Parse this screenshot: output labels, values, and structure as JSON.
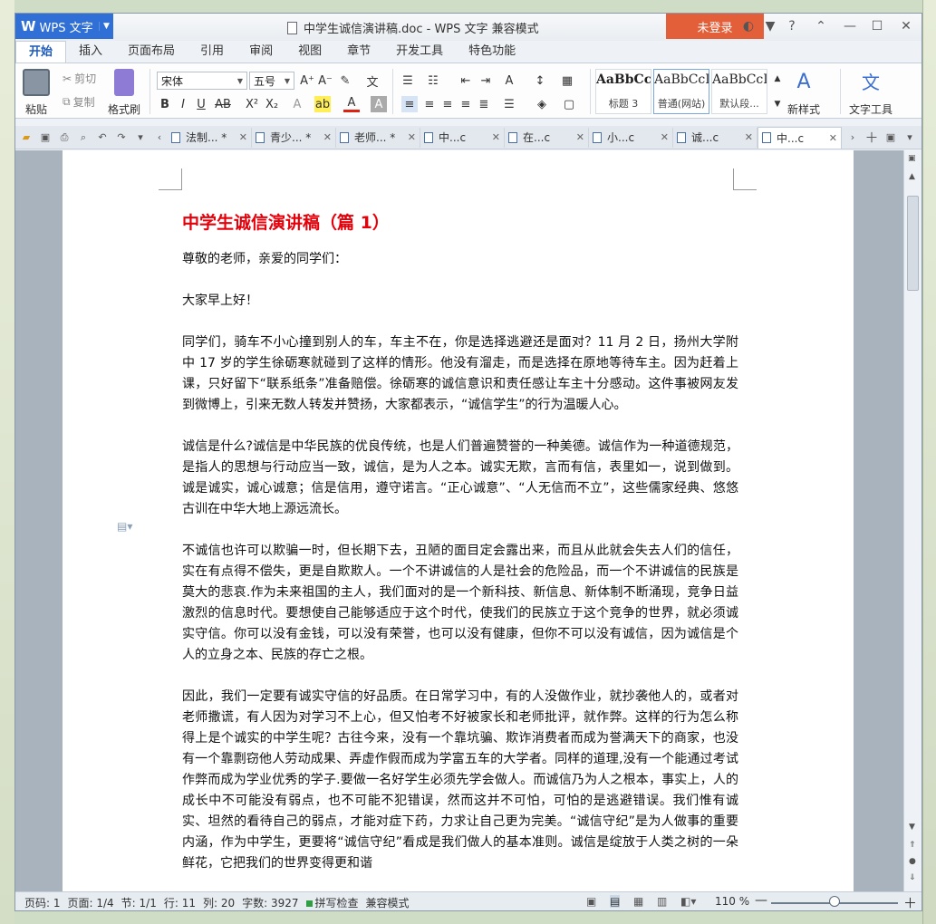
{
  "app": {
    "menu_label": "WPS 文字",
    "logo": "W"
  },
  "title": {
    "text": "中学生诚信演讲稿.doc - WPS 文字 兼容模式"
  },
  "login": {
    "label": "未登录"
  },
  "window_controls": {
    "min": "—",
    "max": "☐",
    "close": "✕"
  },
  "ribbon_tabs": [
    "开始",
    "插入",
    "页面布局",
    "引用",
    "审阅",
    "视图",
    "章节",
    "开发工具",
    "特色功能"
  ],
  "ribbon": {
    "paste": "粘贴",
    "cut": "剪切",
    "copy": "复制",
    "format_painter": "格式刷",
    "font_name": "宋体",
    "font_size": "五号",
    "styles": [
      {
        "preview": "AaBbCcI",
        "name": "标题 3"
      },
      {
        "preview": "AaBbCcD",
        "name": "普通(网站)"
      },
      {
        "preview": "AaBbCcDc",
        "name": "默认段..."
      }
    ],
    "new_style": "新样式",
    "text_tools": "文字工具"
  },
  "doc_tabs": [
    {
      "label": "法制... *"
    },
    {
      "label": "青少... *"
    },
    {
      "label": "老师... *"
    },
    {
      "label": "中...c"
    },
    {
      "label": "在...c"
    },
    {
      "label": "小...c"
    },
    {
      "label": "诚...c"
    },
    {
      "label": "中...c",
      "active": true
    }
  ],
  "document": {
    "heading": "中学生诚信演讲稿（篇 1）",
    "paragraphs": [
      "尊敬的老师，亲爱的同学们：",
      "大家早上好！",
      "同学们，骑车不小心撞到别人的车，车主不在，你是选择逃避还是面对？11 月 2 日，扬州大学附中 17 岁的学生徐砺寒就碰到了这样的情形。他没有溜走，而是选择在原地等待车主。因为赶着上课，只好留下“联系纸条”准备赔偿。徐砺寒的诚信意识和责任感让车主十分感动。这件事被网友发到微博上，引来无数人转发并赞扬，大家都表示，“诚信学生”的行为温暖人心。",
      "诚信是什么?诚信是中华民族的优良传统，也是人们普遍赞誉的一种美德。诚信作为一种道德规范，是指人的思想与行动应当一致，诚信，是为人之本。诚实无欺，言而有信，表里如一，说到做到。诚是诚实，诚心诚意；信是信用，遵守诺言。“正心诚意”、“人无信而不立”，这些儒家经典、悠悠古训在中华大地上源远流长。",
      "不诚信也许可以欺骗一时，但长期下去，丑陋的面目定会露出来，而且从此就会失去人们的信任，实在有点得不偿失，更是自欺欺人。一个不讲诚信的人是社会的危险品，而一个不讲诚信的民族是莫大的悲哀.作为未来祖国的主人，我们面对的是一个新科技、新信息、新体制不断涌现，竞争日益激烈的信息时代。要想使自己能够适应于这个时代，使我们的民族立于这个竞争的世界，就必须诚实守信。你可以没有金钱，可以没有荣誉，也可以没有健康，但你不可以没有诚信，因为诚信是个人的立身之本、民族的存亡之根。",
      "因此，我们一定要有诚实守信的好品质。在日常学习中，有的人没做作业，就抄袭他人的，或者对老师撒谎，有人因为对学习不上心，但又怕考不好被家长和老师批评，就作弊。这样的行为怎么称得上是个诚实的中学生呢？古往今来，没有一个靠坑骗、欺诈消费者而成为誉满天下的商家，也没有一个靠剽窃他人劳动成果、弄虚作假而成为学富五车的大学者。同样的道理,没有一个能通过考试作弊而成为学业优秀的学子.要做一名好学生必须先学会做人。而诚信乃为人之根本，事实上，人的成长中不可能没有弱点，也不可能不犯错误，然而这并不可怕，可怕的是逃避错误。我们惟有诚实、坦然的看待自己的弱点，才能对症下药，力求让自己更为完美。“诚信守纪”是为人做事的重要内涵，作为中学生，更要将“诚信守纪”看成是我们做人的基本准则。诚信是绽放于人类之树的一朵鲜花，它把我们的世界变得更和谐"
    ]
  },
  "status": {
    "page": "页码: 1",
    "pages": "页面: 1/4",
    "section": "节: 1/1",
    "row": "行: 11",
    "col": "列: 20",
    "words": "字数: 3927",
    "spell": "拼写检查",
    "compat": "兼容模式",
    "zoom": "110 %",
    "zoom_fraction": 0.5
  },
  "colors": {
    "accent": "#2f6fd6",
    "login": "#e35f3a",
    "heading": "#e5000a"
  }
}
